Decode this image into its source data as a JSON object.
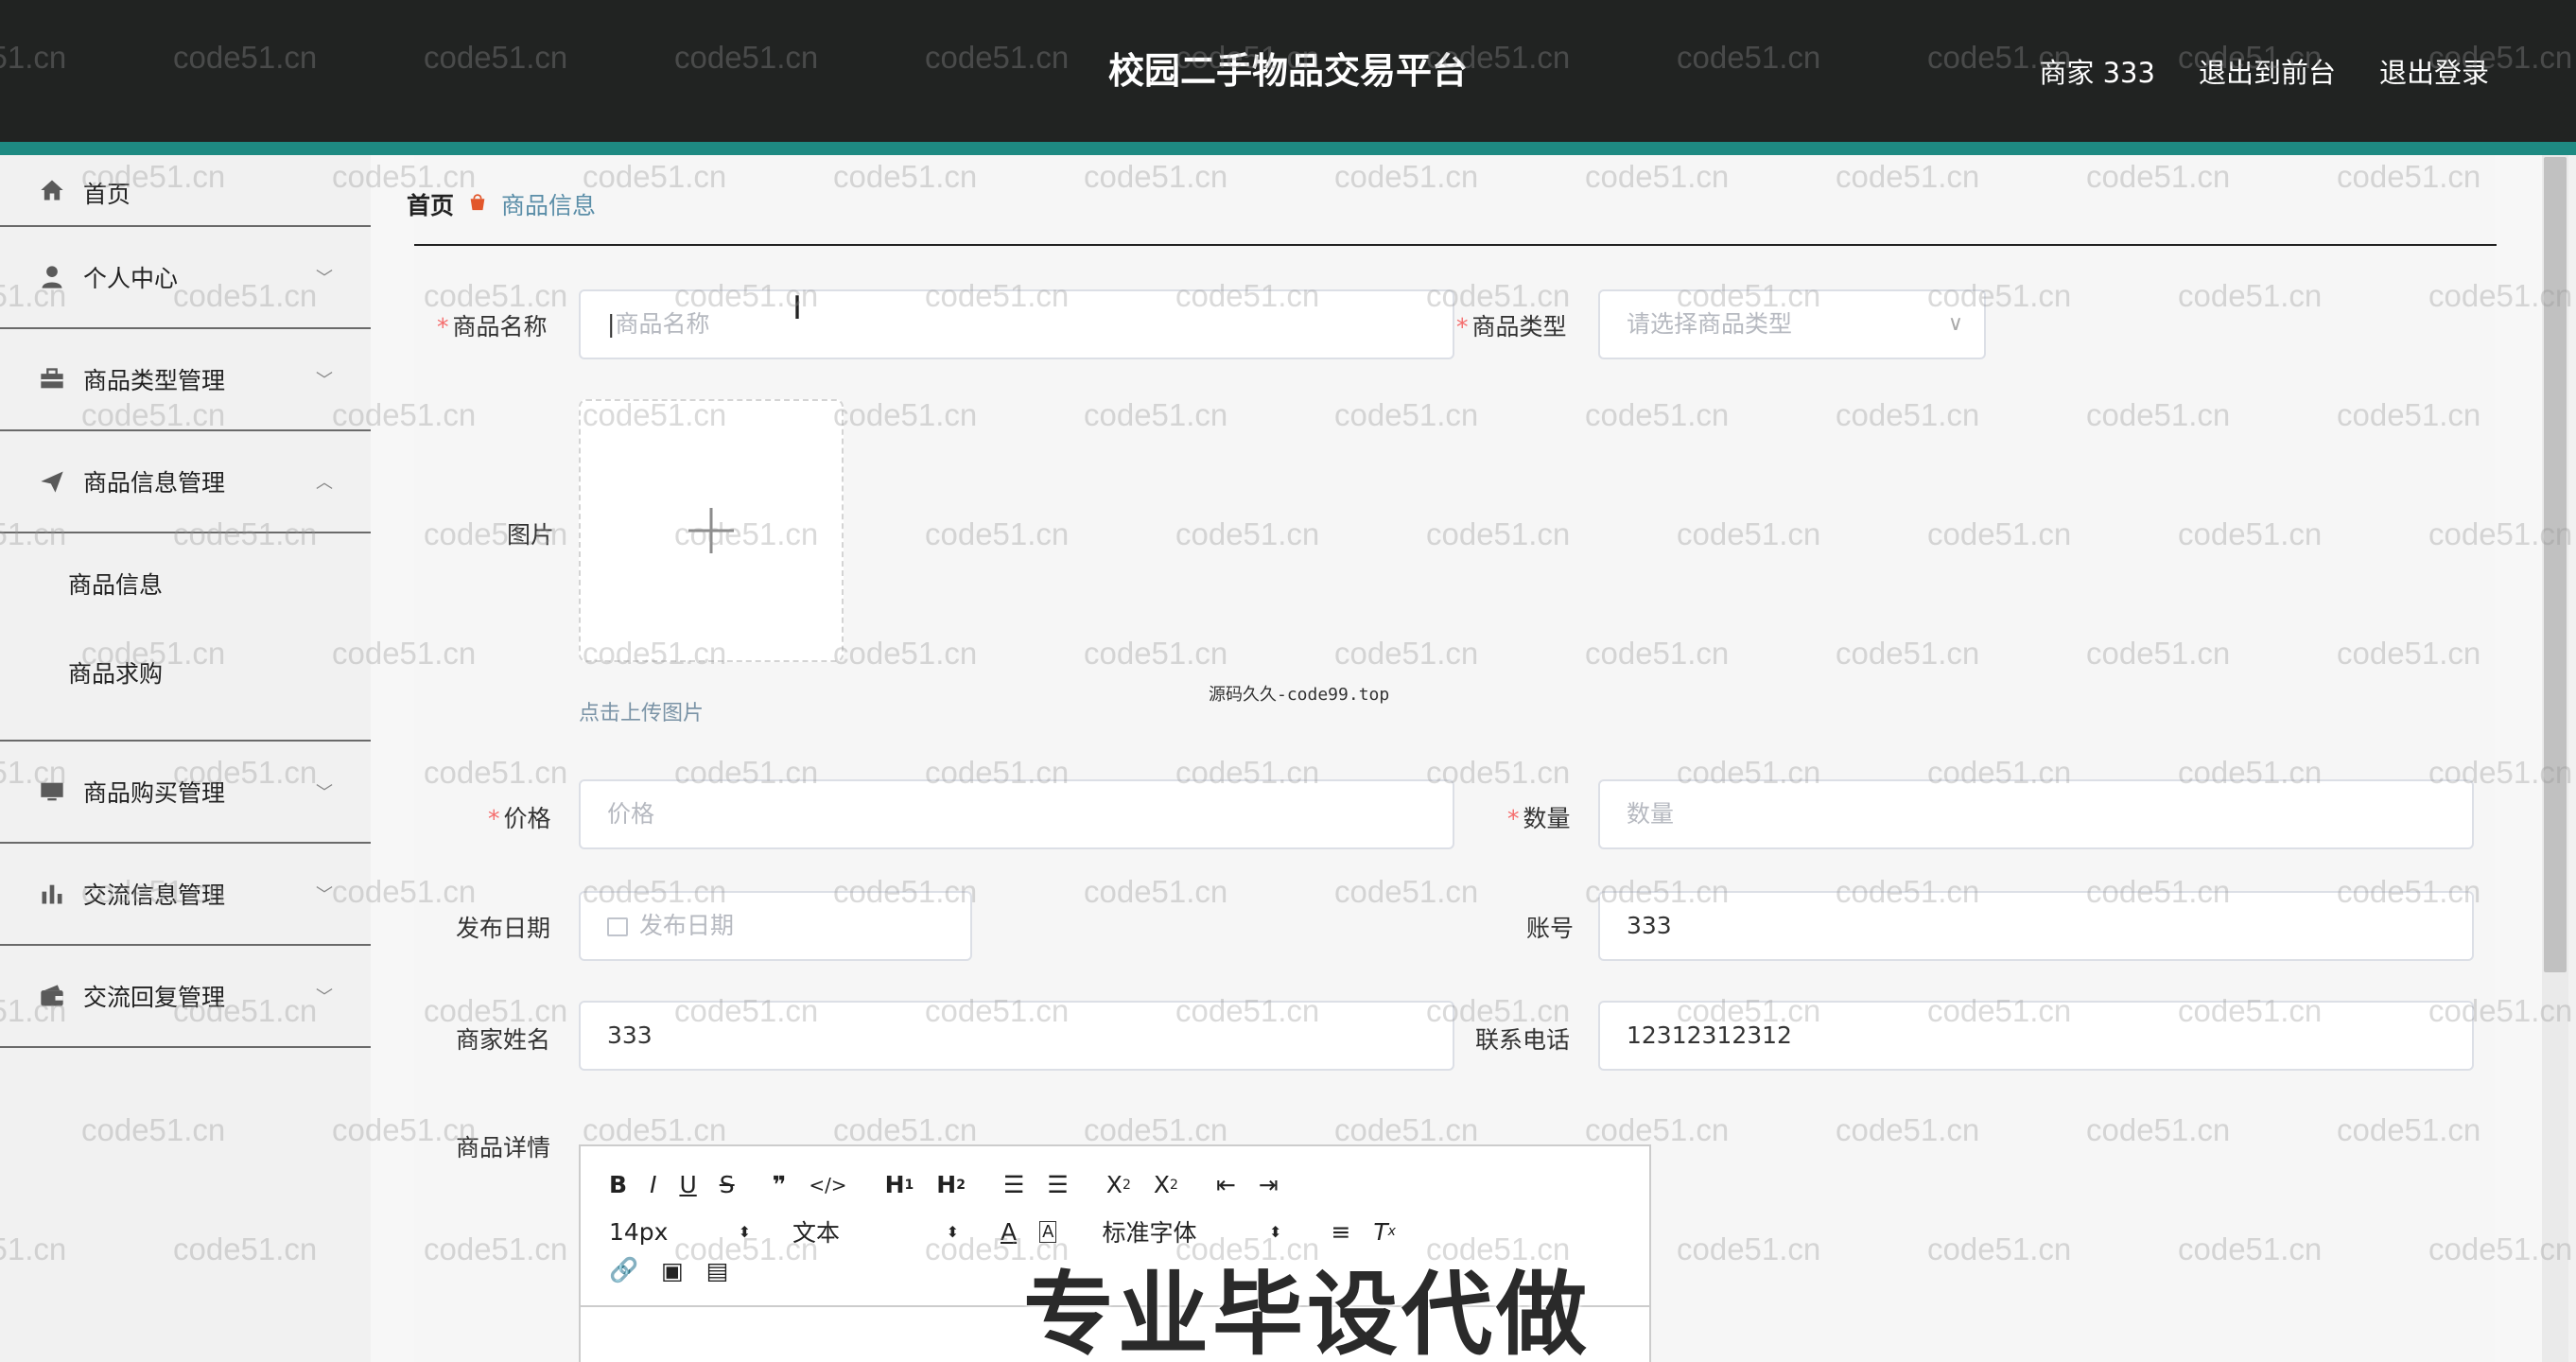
{
  "header": {
    "app_title": "校园二手物品交易平台",
    "user_label": "商家 333",
    "front_link": "退出到前台",
    "logout_link": "退出登录"
  },
  "sidebar": {
    "items": [
      {
        "label": "首页",
        "icon": "home-icon"
      },
      {
        "label": "个人中心",
        "icon": "user-icon"
      },
      {
        "label": "商品类型管理",
        "icon": "briefcase-icon"
      },
      {
        "label": "商品信息管理",
        "icon": "send-icon"
      },
      {
        "label": "商品购买管理",
        "icon": "monitor-icon"
      },
      {
        "label": "交流信息管理",
        "icon": "bar-chart-icon"
      },
      {
        "label": "交流回复管理",
        "icon": "wallet-icon"
      }
    ],
    "submenu": [
      "商品信息",
      "商品求购"
    ]
  },
  "breadcrumb": {
    "home": "首页",
    "current": "商品信息"
  },
  "form": {
    "name_label": "商品名称",
    "name_placeholder": "商品名称",
    "type_label": "商品类型",
    "type_placeholder": "请选择商品类型",
    "image_label": "图片",
    "upload_tip": "点击上传图片",
    "price_label": "价格",
    "price_placeholder": "价格",
    "qty_label": "数量",
    "qty_placeholder": "数量",
    "date_label": "发布日期",
    "date_placeholder": "发布日期",
    "account_label": "账号",
    "account_value": "333",
    "merchant_label": "商家姓名",
    "merchant_value": "333",
    "phone_label": "联系电话",
    "phone_value": "12312312312",
    "detail_label": "商品详情"
  },
  "editor": {
    "font_size": "14px",
    "text_style": "文本",
    "font_family": "标准字体"
  },
  "watermark": "code51.cn",
  "center_note": "源码久久-code99.top",
  "overlay_banner": "专业毕设代做",
  "colors": {
    "header_bg": "#212322",
    "accent_bar": "#1e8a82",
    "required": "#f56c6c",
    "breadcrumb_sep": "#e2572b"
  }
}
